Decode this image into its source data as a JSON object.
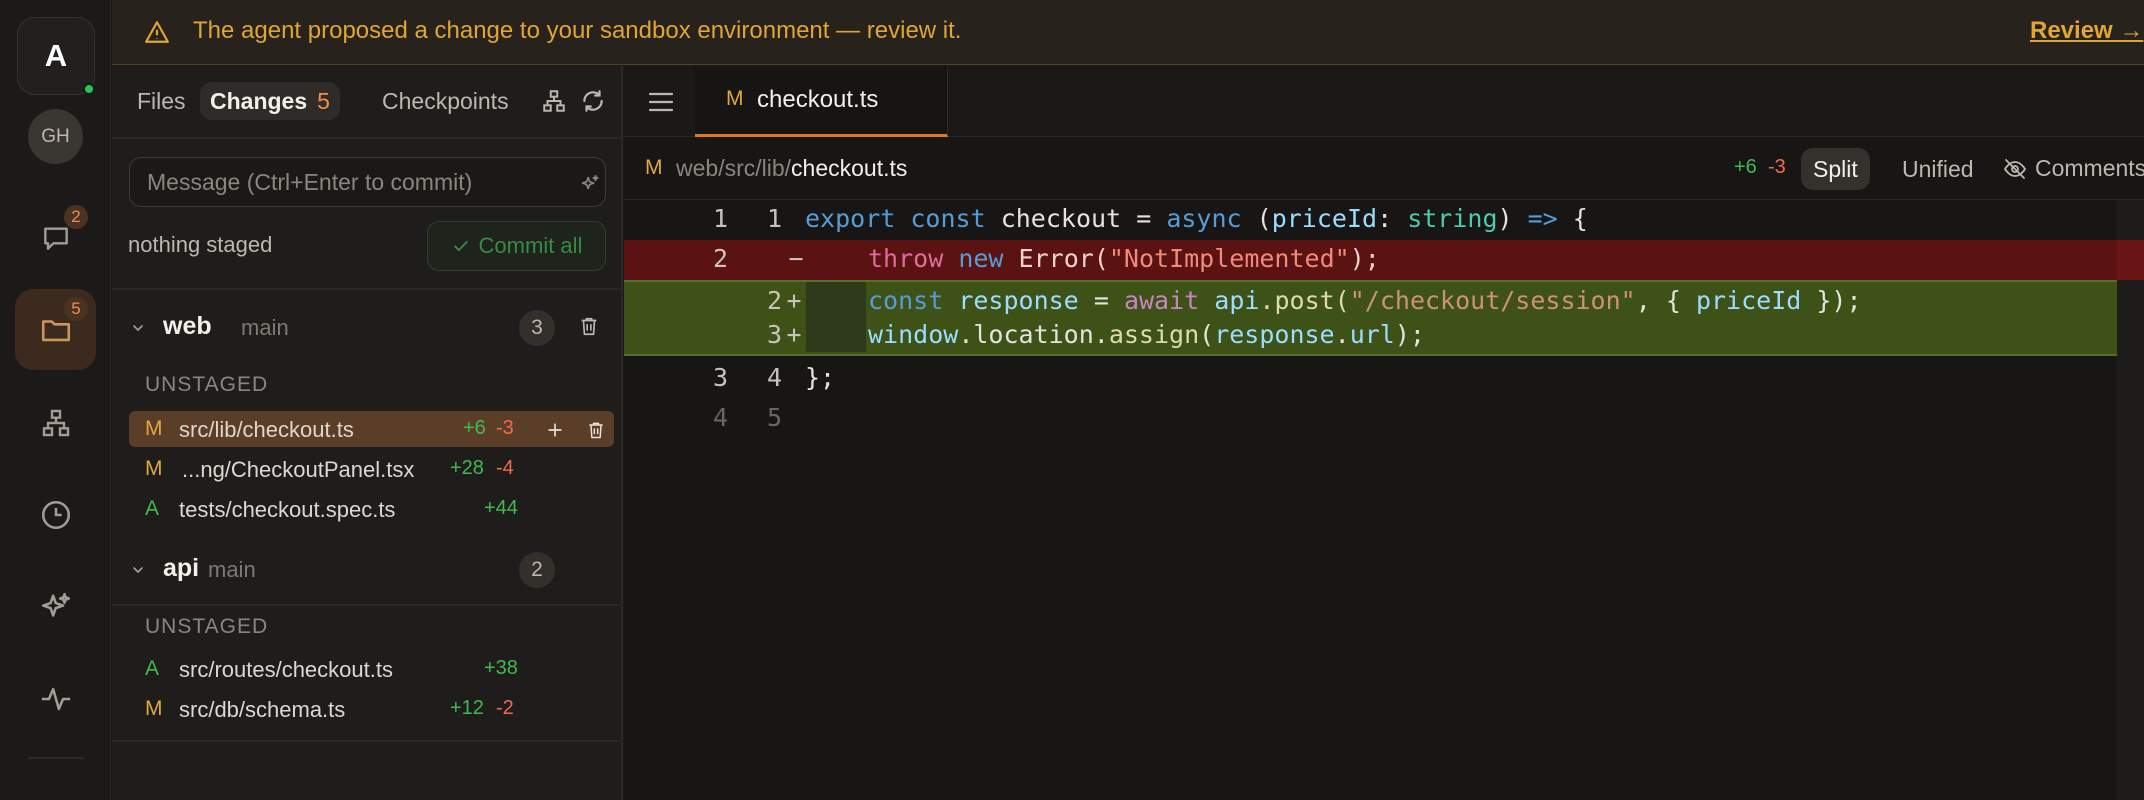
{
  "banner": {
    "message": "The agent proposed a change to your sandbox environment — review it.",
    "review_label": "Review →"
  },
  "rail": {
    "logo": "A",
    "avatar": "GH",
    "chat_badge": "2",
    "files_badge": "5"
  },
  "panel": {
    "tabs": {
      "files": "Files",
      "changes": "Changes",
      "changes_count": "5",
      "checkpoints": "Checkpoints"
    },
    "commit_placeholder": "Message (Ctrl+Enter to commit)",
    "nothing_staged": "nothing staged",
    "commit_all": "Commit all",
    "groups": [
      {
        "name": "web",
        "branch": "main",
        "count": "3",
        "section": "UNSTAGED",
        "files": [
          {
            "status": "M",
            "path": "src/lib/checkout.ts",
            "add": "+6",
            "del": "-3"
          },
          {
            "status": "M",
            "path": "...ng/CheckoutPanel.tsx",
            "add": "+28",
            "del": "-4"
          },
          {
            "status": "A",
            "path": "tests/checkout.spec.ts",
            "add": "+44",
            "del": ""
          }
        ]
      },
      {
        "name": "api",
        "branch": "main",
        "count": "2",
        "section": "UNSTAGED",
        "files": [
          {
            "status": "A",
            "path": "src/routes/checkout.ts",
            "add": "+38",
            "del": ""
          },
          {
            "status": "M",
            "path": "src/db/schema.ts",
            "add": "+12",
            "del": "-2"
          }
        ]
      }
    ]
  },
  "editor": {
    "tab": {
      "status": "M",
      "name": "checkout.ts"
    },
    "path": {
      "status": "M",
      "dir": "web/src/lib/",
      "file": "checkout.ts"
    },
    "additions": "+6",
    "deletions": "-3",
    "view_split": "Split",
    "view_unified": "Unified",
    "comments": "Comments",
    "lines": [
      {
        "kind": "ctx",
        "old": "1",
        "new": "1",
        "marker": ""
      },
      {
        "kind": "del",
        "old": "2",
        "new": "",
        "marker": "−"
      },
      {
        "kind": "ins",
        "old": "",
        "new": "2",
        "marker": "+"
      },
      {
        "kind": "ins",
        "old": "",
        "new": "3",
        "marker": "+"
      },
      {
        "kind": "ctx",
        "old": "3",
        "new": "4",
        "marker": ""
      },
      {
        "kind": "ctx",
        "old": "4",
        "new": "5",
        "marker": ""
      }
    ],
    "code": {
      "l1": {
        "a": "export",
        "b": "const",
        "c": "checkout",
        "d": "=",
        "e": "async",
        "f": "(",
        "g": "priceId",
        "h": ":",
        "i": "string",
        "j": ")",
        "k": "=>",
        "l": "{"
      },
      "l2": {
        "a": "throw",
        "b": "new",
        "c": "Error(",
        "d": "\"NotImplemented\"",
        "e": ");"
      },
      "l3": {
        "a": "const",
        "b": "response",
        "c": "=",
        "d": "await",
        "e": "api",
        "f": ".post(",
        "g": "\"/checkout/session\"",
        "h": ", {",
        "i": "priceId",
        "j": "});"
      },
      "l4": {
        "a": "window",
        "b": ".location.",
        "c": "assign",
        "d": "(",
        "e": "response",
        "f": ".",
        "g": "url",
        "h": ");"
      },
      "l5": {
        "a": "};"
      }
    }
  }
}
